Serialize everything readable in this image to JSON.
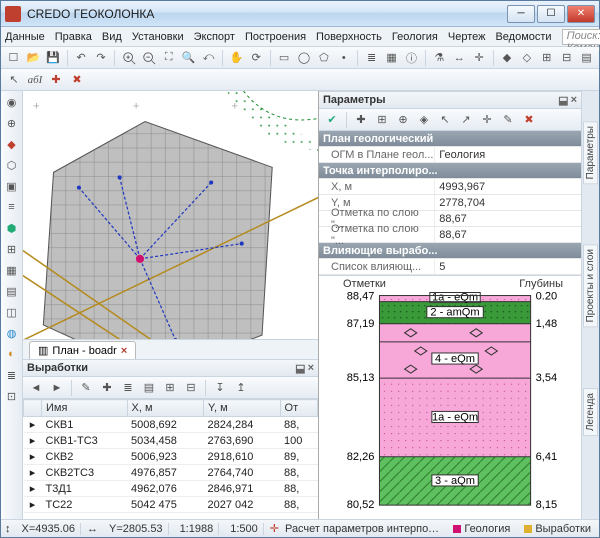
{
  "title": "CREDO ГЕОКОЛОНКА",
  "menu": [
    "Данные",
    "Правка",
    "Вид",
    "Установки",
    "Экспорт",
    "Построения",
    "Поверхность",
    "Геология",
    "Чертеж",
    "Ведомости"
  ],
  "search_placeholder": "Поиск: Команда (Ctrl + Q)",
  "plan_tab": "План - boadr",
  "panels": {
    "vyrabotki": "Выработки",
    "parametry": "Параметры"
  },
  "grid": {
    "cols": [
      "Имя",
      "X, м",
      "Y, м",
      "От"
    ],
    "rows": [
      [
        "СКВ1",
        "5008,692",
        "2824,284",
        "88,"
      ],
      [
        "СКВ1-ТС3",
        "5034,458",
        "2763,690",
        "100"
      ],
      [
        "СКВ2",
        "5006,923",
        "2918,610",
        "89,"
      ],
      [
        "СКВ2ТС3",
        "4976,857",
        "2764,740",
        "88,"
      ],
      [
        "Т3Д1",
        "4962,076",
        "2846,971",
        "88,"
      ],
      [
        "ТС22",
        "5042 475",
        "2027 042",
        "88,"
      ]
    ]
  },
  "props": {
    "group1": "План геологический",
    "r1l": "ОГМ в Плане геол...",
    "r1v": "Геология",
    "group2": "Точка интерполиро...",
    "r2l": "X, м",
    "r2v": "4993,967",
    "r3l": "Y, м",
    "r3v": "2778,704",
    "r4l": "Отметка по слою \"...",
    "r4v": "88,67",
    "r5l": "Отметка по слою \"...",
    "r5v": "88,67",
    "group3": "Влияющие вырабо...",
    "r6l": "Список влияющ...",
    "r6v": "5"
  },
  "column": {
    "left_hdr": "Отметки",
    "right_hdr": "Глубины",
    "left_ticks": [
      "88,47",
      "87,19",
      "85,13",
      "82,26",
      "80,52"
    ],
    "right_ticks": [
      "0.20",
      "1,48",
      "3,54",
      "6,41",
      "8,15"
    ],
    "layers": [
      "1a - eQm",
      "2 - amQm",
      "",
      "4 - eQm",
      "1a - eQm",
      "3 - aQm"
    ]
  },
  "side_tabs": [
    "Параметры",
    "Проекты и слои",
    "Легенда"
  ],
  "status": {
    "x": "X=4935.06",
    "y": "Y=2805.53",
    "scale": "1:1988",
    "ratio": "1:500",
    "msg": "Расчет параметров интерполированной колонки в произвольной",
    "tag1": "Геология",
    "tag2": "Выработки"
  }
}
